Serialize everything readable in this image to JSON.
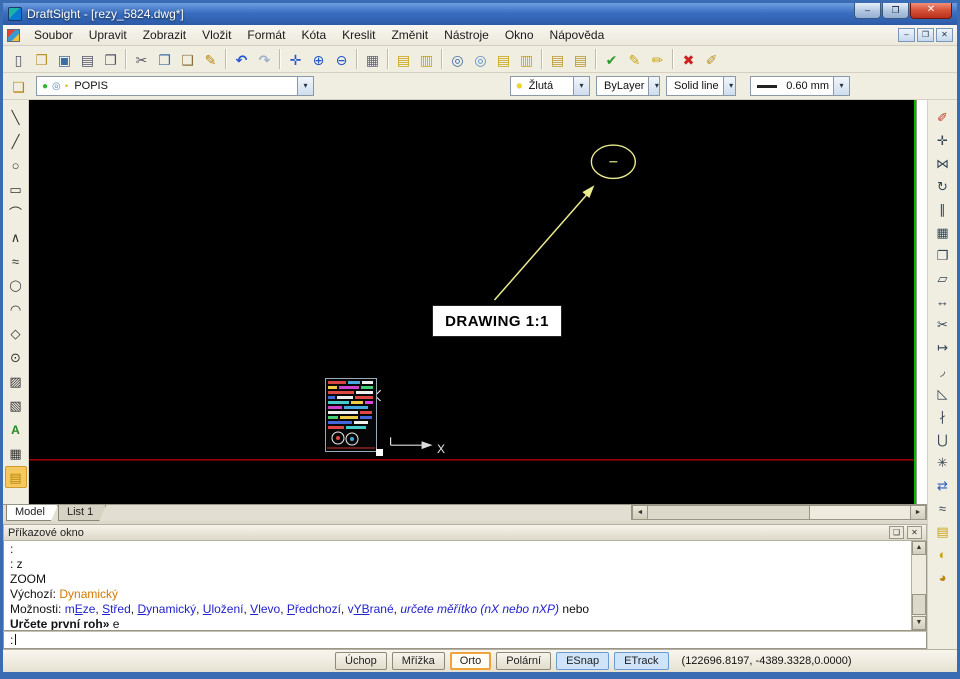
{
  "window": {
    "title": "DraftSight - [rezy_5824.dwg*]",
    "controls": {
      "minimize": "–",
      "maximize": "❐",
      "close": "✕"
    }
  },
  "menu": {
    "items": [
      {
        "name": "menu-soubor",
        "label": "Soubor"
      },
      {
        "name": "menu-upravit",
        "label": "Upravit"
      },
      {
        "name": "menu-zobrazit",
        "label": "Zobrazit"
      },
      {
        "name": "menu-vlozit",
        "label": "Vložit"
      },
      {
        "name": "menu-format",
        "label": "Formát"
      },
      {
        "name": "menu-kota",
        "label": "Kóta"
      },
      {
        "name": "menu-kreslit",
        "label": "Kreslit"
      },
      {
        "name": "menu-zmenit",
        "label": "Změnit"
      },
      {
        "name": "menu-nastroje",
        "label": "Nástroje"
      },
      {
        "name": "menu-okno",
        "label": "Okno"
      },
      {
        "name": "menu-napoveda",
        "label": "Nápověda"
      }
    ],
    "child_controls": {
      "minimize": "–",
      "restore": "❐",
      "close": "✕"
    }
  },
  "toolbar_main": {
    "groups": [
      [
        {
          "name": "new-icon",
          "glyph": "▯",
          "style": "color:#556"
        },
        {
          "name": "open-icon",
          "glyph": "❒",
          "style": "color:#b8962e"
        },
        {
          "name": "save-icon",
          "glyph": "▣",
          "style": "color:#3a6ea5"
        },
        {
          "name": "print-icon",
          "glyph": "▤",
          "style": "color:#556"
        },
        {
          "name": "print-preview-icon",
          "glyph": "❐",
          "style": "color:#556"
        }
      ],
      [
        {
          "name": "cut-icon",
          "glyph": "✂",
          "style": "color:#556"
        },
        {
          "name": "copy-icon",
          "glyph": "❐",
          "style": "color:#3a6ea5"
        },
        {
          "name": "paste-icon",
          "glyph": "❑",
          "style": "color:#8a6d3b"
        },
        {
          "name": "format-painter-icon",
          "glyph": "✎",
          "style": "color:#b8860b"
        }
      ],
      [
        {
          "name": "undo-icon",
          "glyph": "↶",
          "style": "color:#2255cc;font-weight:bold"
        },
        {
          "name": "redo-icon",
          "glyph": "↷",
          "style": "color:#9fb0cc;font-weight:bold"
        }
      ],
      [
        {
          "name": "pan-icon",
          "glyph": "✛",
          "style": "color:#2255cc"
        },
        {
          "name": "zoom-dynamic-icon",
          "glyph": "⊕",
          "style": "color:#2255cc"
        },
        {
          "name": "zoom-back-icon",
          "glyph": "⊖",
          "style": "color:#2255cc"
        }
      ],
      [
        {
          "name": "snap-settings-icon",
          "glyph": "▦",
          "style": "color:#667"
        }
      ],
      [
        {
          "name": "layers-manager-icon",
          "glyph": "▤",
          "style": "color:#c8a416"
        },
        {
          "name": "layer-preview-icon",
          "glyph": "▥",
          "style": "color:#c8a416"
        }
      ],
      [
        {
          "name": "link-icon",
          "glyph": "◎",
          "style": "color:#3a6ea5"
        },
        {
          "name": "link-frame-icon",
          "glyph": "◎",
          "style": "color:#5a8ec5"
        },
        {
          "name": "layer-states-icon",
          "glyph": "▤",
          "style": "color:#c8a416"
        },
        {
          "name": "layer-tools-icon",
          "glyph": "▥",
          "style": "color:#c8a416"
        }
      ],
      [
        {
          "name": "sheet-icon",
          "glyph": "▤",
          "style": "color:#b8962e"
        },
        {
          "name": "sheet-set-icon",
          "glyph": "▤",
          "style": "color:#b8962e"
        }
      ],
      [
        {
          "name": "check-standards-icon",
          "glyph": "✔",
          "style": "color:#2a9a2a;font-weight:bold"
        },
        {
          "name": "edit-standards-icon",
          "glyph": "✎",
          "style": "color:#c8a416"
        },
        {
          "name": "annotate-icon",
          "glyph": "✏",
          "style": "color:#c8a416"
        }
      ],
      [
        {
          "name": "delete-tool-icon",
          "glyph": "✖",
          "style": "color:#cc2222"
        },
        {
          "name": "clean-screen-icon",
          "glyph": "✐",
          "style": "color:#b8962e"
        }
      ]
    ]
  },
  "toolbar_props": {
    "layers_tool_glyph": "❏",
    "layer_icons": {
      "on": "●",
      "lock": "◎",
      "swatch": "▪"
    },
    "layer_value": "POPIS",
    "color_swatch": "●",
    "color_value": "Žlutá",
    "linestyle_value": "ByLayer",
    "linetype_value": "Solid line",
    "lineweight_value": "0.60 mm"
  },
  "palette_left": [
    {
      "name": "line-tool",
      "glyph": "╲",
      "style": "color:#333"
    },
    {
      "name": "construction-line-tool",
      "glyph": "╱",
      "style": "color:#333"
    },
    {
      "name": "circle-tool",
      "glyph": "○",
      "style": "color:#333"
    },
    {
      "name": "rectangle-tool",
      "glyph": "▭",
      "style": "color:#333"
    },
    {
      "name": "arc-tool",
      "glyph": "⌒",
      "style": "color:#333"
    },
    {
      "name": "polyline-tool",
      "glyph": "∧",
      "style": "color:#333"
    },
    {
      "name": "spline-tool",
      "glyph": "≈",
      "style": "color:#333"
    },
    {
      "name": "ellipse-tool",
      "glyph": "◯",
      "style": "color:#333;font-size:11px"
    },
    {
      "name": "ellipse-arc-tool",
      "glyph": "◠",
      "style": "color:#333"
    },
    {
      "name": "polygon-tool",
      "glyph": "◇",
      "style": "color:#333"
    },
    {
      "name": "point-tool",
      "glyph": "⊙",
      "style": "color:#333"
    },
    {
      "name": "hatch-tool",
      "glyph": "▨",
      "style": "color:#333"
    },
    {
      "name": "region-tool",
      "glyph": "▧",
      "style": "color:#333"
    },
    {
      "name": "text-tool",
      "glyph": "A",
      "style": "color:#1f8a1f;font-weight:bold;font-size:12px"
    },
    {
      "name": "table-tool",
      "glyph": "▦",
      "style": "color:#333"
    },
    {
      "name": "note-tool",
      "glyph": "▤",
      "style": "color:#b8860b",
      "cls": "active"
    }
  ],
  "palette_right": [
    {
      "name": "erase-tool",
      "glyph": "✐",
      "style": "color:#c23b2b"
    },
    {
      "name": "move-tool",
      "glyph": "✛",
      "style": "color:#345"
    },
    {
      "name": "mirror-tool",
      "glyph": "⋈",
      "style": "color:#345"
    },
    {
      "name": "rotate-tool",
      "glyph": "↻",
      "style": "color:#345"
    },
    {
      "name": "offset-tool",
      "glyph": "∥",
      "style": "color:#345"
    },
    {
      "name": "pattern-tool",
      "glyph": "▦",
      "style": "color:#345"
    },
    {
      "name": "copy-entity-tool",
      "glyph": "❐",
      "style": "color:#345"
    },
    {
      "name": "scale-tool",
      "glyph": "▱",
      "style": "color:#345"
    },
    {
      "name": "stretch-tool",
      "glyph": "↔",
      "style": "color:#345"
    },
    {
      "name": "trim-tool",
      "glyph": "✂",
      "style": "color:#345"
    },
    {
      "name": "extend-tool",
      "glyph": "↦",
      "style": "color:#345"
    },
    {
      "name": "fillet-tool",
      "glyph": "◞",
      "style": "color:#345"
    },
    {
      "name": "chamfer-tool",
      "glyph": "◺",
      "style": "color:#345"
    },
    {
      "name": "split-tool",
      "glyph": "∤",
      "style": "color:#345"
    },
    {
      "name": "weld-tool",
      "glyph": "⋃",
      "style": "color:#345"
    },
    {
      "name": "explode-tool",
      "glyph": "✳",
      "style": "color:#345"
    },
    {
      "name": "swap-arrows-icon",
      "glyph": "⇄",
      "style": "color:#2b5bc0"
    },
    {
      "name": "edit-polyline-tool",
      "glyph": "≈",
      "style": "color:#345"
    },
    {
      "name": "layer-sheet-icon",
      "glyph": "▤",
      "style": "color:#c8a416"
    },
    {
      "name": "brightness-icon",
      "glyph": "◐",
      "style": "color:#c8a416"
    },
    {
      "name": "purge-icon",
      "glyph": "◕",
      "style": "color:#b8860b"
    }
  ],
  "canvas": {
    "label": "DRAWING 1:1",
    "axis_label": "X"
  },
  "tabs": {
    "model": "Model",
    "list1": "List 1"
  },
  "command_window": {
    "title": "Příkazové okno",
    "lines": [
      [
        {
          "t": ":"
        }
      ],
      [
        {
          "t": ": z"
        }
      ],
      [
        {
          "t": "ZOOM"
        }
      ],
      [
        {
          "t": "Výchozí: "
        },
        {
          "t": "Dynamický",
          "s": "c-orange"
        }
      ],
      [
        {
          "t": "Možnosti: "
        },
        {
          "t": "m",
          "s": "c-opt"
        },
        {
          "t": "E",
          "s": "c-hot"
        },
        {
          "t": "ze",
          "s": "c-opt"
        },
        {
          "t": ", "
        },
        {
          "t": "S",
          "s": "c-hot"
        },
        {
          "t": "třed",
          "s": "c-opt"
        },
        {
          "t": ", "
        },
        {
          "t": "D",
          "s": "c-hot"
        },
        {
          "t": "ynamický",
          "s": "c-opt"
        },
        {
          "t": ", "
        },
        {
          "t": "U",
          "s": "c-hot"
        },
        {
          "t": "ložení",
          "s": "c-opt"
        },
        {
          "t": ", "
        },
        {
          "t": "V",
          "s": "c-hot"
        },
        {
          "t": "levo",
          "s": "c-opt"
        },
        {
          "t": ", "
        },
        {
          "t": "P",
          "s": "c-hot"
        },
        {
          "t": "ředchozí",
          "s": "c-opt"
        },
        {
          "t": ", "
        },
        {
          "t": "v",
          "s": "c-opt"
        },
        {
          "t": "YB",
          "s": "c-hot"
        },
        {
          "t": "rané",
          "s": "c-opt"
        },
        {
          "t": ", "
        },
        {
          "t": "určete měřítko (nX nebo nXP)",
          "s": "c-ital"
        },
        {
          "t": " nebo"
        }
      ],
      [
        {
          "t": "Určete první roh» ",
          "s": "c-bold"
        },
        {
          "t": "e"
        }
      ]
    ],
    "prompt": ":"
  },
  "status_bar": {
    "buttons": [
      {
        "name": "status-uchop",
        "label": "Úchop",
        "cls": ""
      },
      {
        "name": "status-mrizka",
        "label": "Mřížka",
        "cls": ""
      },
      {
        "name": "status-orto",
        "label": "Orto",
        "cls": "sb-orto"
      },
      {
        "name": "status-polarni",
        "label": "Polární",
        "cls": ""
      },
      {
        "name": "status-esnap",
        "label": "ESnap",
        "cls": "sb-on"
      },
      {
        "name": "status-etrack",
        "label": "ETrack",
        "cls": "sb-on"
      }
    ],
    "coordinates": "(122696.8197, -4389.3328,0.0000)"
  },
  "ui": {
    "dropdown_glyph": "▾",
    "left_arrow": "◄",
    "right_arrow": "►",
    "up_arrow": "▲",
    "down_arrow": "▼",
    "float_glyph": "❏",
    "close_glyph": "✕"
  },
  "colors": {
    "accent_yellow": "#ebeb8f",
    "entity_red": "#c40000",
    "viewport_green": "#00b800",
    "active_toggle_blue": "#cfe4f8",
    "orto_highlight_orange": "#f0a23c"
  }
}
